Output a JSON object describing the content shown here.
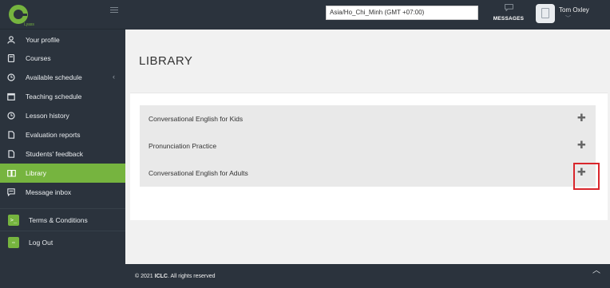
{
  "colors": {
    "accent": "#76b43f",
    "dark": "#2b333d",
    "highlight": "#d9262c"
  },
  "sidebar": {
    "items": [
      {
        "label": "Your profile",
        "icon": "user-icon"
      },
      {
        "label": "Courses",
        "icon": "book-icon"
      },
      {
        "label": "Available schedule",
        "icon": "clock-icon"
      },
      {
        "label": "Teaching schedule",
        "icon": "calendar-icon"
      },
      {
        "label": "Lesson history",
        "icon": "clock-icon"
      },
      {
        "label": "Evaluation reports",
        "icon": "document-icon"
      },
      {
        "label": "Students' feedback",
        "icon": "document-icon"
      },
      {
        "label": "Library",
        "icon": "open-book-icon",
        "active": true
      },
      {
        "label": "Message inbox",
        "icon": "chat-icon"
      }
    ],
    "bottom": [
      {
        "label": "Terms & Conditions",
        "icon": "terminal-icon"
      },
      {
        "label": "Log Out",
        "icon": "logout-icon"
      }
    ]
  },
  "header": {
    "timezone": "Asia/Ho_Chi_Minh (GMT +07:00)",
    "messages_label": "MESSAGES",
    "user_name": "Tom Oxley"
  },
  "main": {
    "title": "LIBRARY",
    "items": [
      "Conversational English for Kids",
      "Pronunciation Practice",
      "Conversational English for Adults"
    ]
  },
  "footer": {
    "copyright_prefix": "© 2021 ",
    "brand": "ICLC",
    "copyright_suffix": ". All rights reserved"
  }
}
